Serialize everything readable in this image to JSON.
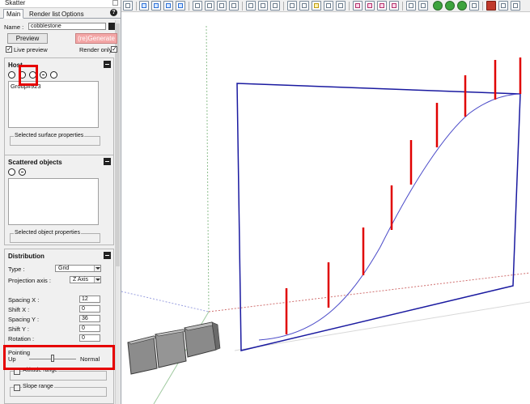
{
  "window": {
    "title": "Skatter"
  },
  "tabs": {
    "main": "Main",
    "render_list": "Render list",
    "options": "Options",
    "help": "?"
  },
  "name_field": {
    "label": "Name :",
    "value": "cobblestone"
  },
  "buttons": {
    "preview": "Preview",
    "regenerate": "(re)Generate"
  },
  "live_preview": {
    "label": "Live preview",
    "checked": true
  },
  "render_only": {
    "label": "Render only",
    "checked": true
  },
  "hosts": {
    "title": "Host",
    "items": [
      "Group#923"
    ],
    "selected_properties": "Selected surface properties"
  },
  "scattered_objects": {
    "title": "Scattered objects",
    "selected_properties": "Selected object properties"
  },
  "distribution": {
    "title": "Distribution",
    "type": {
      "label": "Type :",
      "value": "Grid"
    },
    "projection_axis": {
      "label": "Projection axis :",
      "value": "Z Axis"
    },
    "spacing_x": {
      "label": "Spacing X :",
      "value": "12"
    },
    "shift_x": {
      "label": "Shift X :",
      "value": "0"
    },
    "spacing_y": {
      "label": "Spacing Y :",
      "value": "36"
    },
    "shift_y": {
      "label": "Shift Y :",
      "value": "0"
    },
    "rotation": {
      "label": "Rotation :",
      "value": "0"
    }
  },
  "pointing": {
    "title": "Pointing",
    "left": "Up",
    "right": "Normal",
    "slider_value": 0.5
  },
  "altitude_range": {
    "label": "Altitude range"
  },
  "slope_range": {
    "label": "Slope range"
  },
  "colors": {
    "highlight": "#e60000",
    "plane": "#1a1aa0",
    "curve": "#4a4ac8",
    "pins": "#e00000"
  }
}
